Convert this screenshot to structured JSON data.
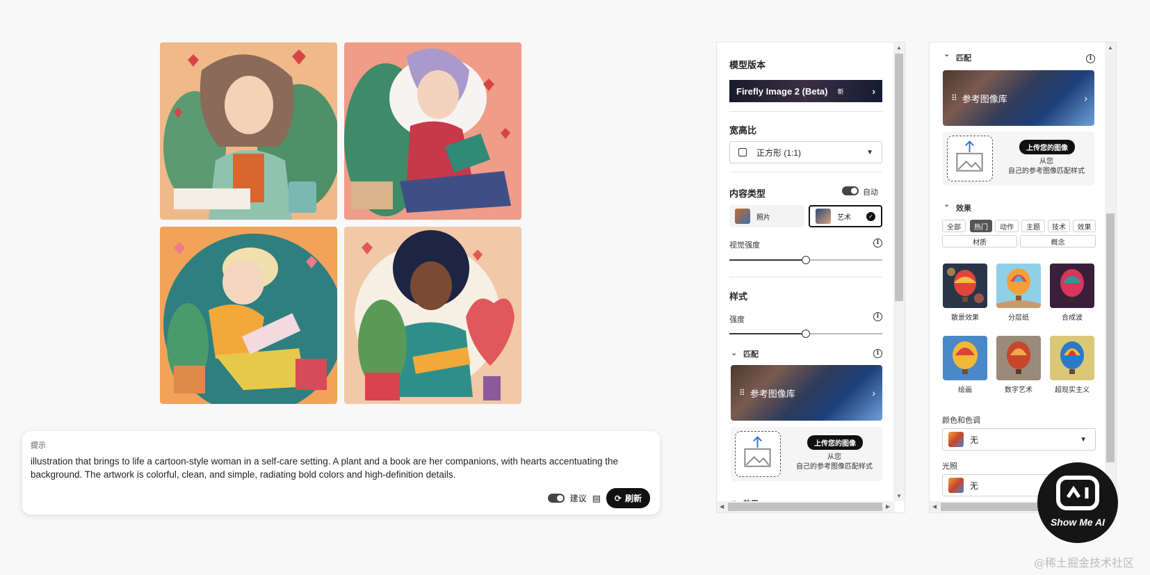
{
  "prompt": {
    "label": "提示",
    "text": "illustration that brings to life a cartoon-style woman in a self-care setting. A plant and a book are her companions, with hearts accentuating the background. The artwork is colorful, clean, and simple, radiating bold colors and high-definition details.",
    "suggest_label": "建议",
    "refresh_label": "刷新"
  },
  "panel_a": {
    "model_version_title": "模型版本",
    "model_name": "Firefly Image 2 (Beta)",
    "model_badge": "新",
    "aspect_title": "宽高比",
    "aspect_value": "正方形 (1:1)",
    "content_type_title": "内容类型",
    "auto_label": "自动",
    "type_photo": "照片",
    "type_art": "艺术",
    "visual_intensity_label": "视觉强度",
    "visual_intensity": 0.5,
    "style_title": "样式",
    "strength_label": "强度",
    "strength": 0.5,
    "match_title": "匹配",
    "ref_gallery_label": "参考图像库",
    "upload_button": "上传您的图像",
    "upload_text_1": "从您",
    "upload_text_2": "自己的参考图像匹配样式",
    "effects_title": "效果"
  },
  "panel_b": {
    "match_title": "匹配",
    "ref_gallery_label": "参考图像库",
    "upload_button": "上传您的图像",
    "upload_text_1": "从您",
    "upload_text_2": "自己的参考图像匹配样式",
    "effects_title": "效果",
    "chips_row1": [
      "全部",
      "热门",
      "动作",
      "主题",
      "技术",
      "效果"
    ],
    "chips_row2": [
      "材质",
      "概念"
    ],
    "active_chip": "热门",
    "effects": [
      "散景效果",
      "分层纸",
      "合成波",
      "绘画",
      "数字艺术",
      "超现实主义"
    ],
    "color_tone_label": "颜色和色调",
    "color_tone_value": "无",
    "lighting_label": "光照",
    "lighting_value": "无"
  },
  "branding": {
    "logo_text": "Show Me AI",
    "watermark": "@稀土掘金技术社区"
  }
}
